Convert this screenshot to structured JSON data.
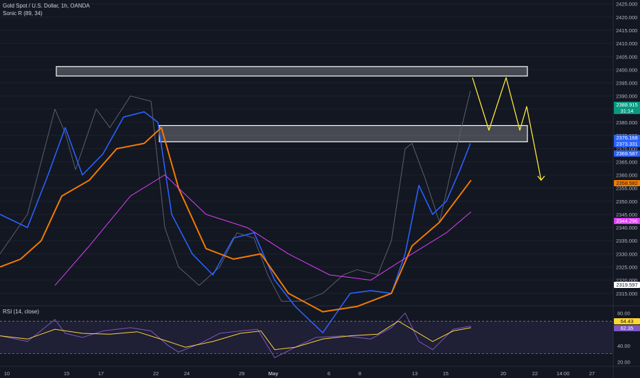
{
  "header": {
    "symbol_line": "Gold Spot / U.S. Dollar, 1h, OANDA",
    "indicator": "Sonic R (89, 34)",
    "rsi_label": "RSI (14, close)"
  },
  "colors": {
    "background": "#131722",
    "ema_fast": "#2962ff",
    "ema_slow": "#f57c00",
    "long_ma": "#e040fb",
    "projection": "#ffeb3b",
    "zone_fill": "rgba(255,255,255,0.22)",
    "rsi": "#7e57c2",
    "rsi_ma": "#fdd835"
  },
  "chart_data": [
    {
      "type": "line",
      "title": "Gold Spot / U.S. Dollar, 1h, OANDA",
      "x_labels": [
        "10",
        "15",
        "17",
        "22",
        "24",
        "29",
        "May",
        "6",
        "8",
        "13",
        "15",
        "20",
        "22",
        "14:00",
        "27"
      ],
      "y_ticks": [
        2315.0,
        2320.0,
        2325.0,
        2330.0,
        2335.0,
        2340.0,
        2345.0,
        2350.0,
        2355.0,
        2360.0,
        2365.0,
        2370.0,
        2375.0,
        2380.0,
        2385.0,
        2390.0,
        2395.0,
        2400.0,
        2405.0,
        2410.0,
        2415.0,
        2420.0,
        2425.0
      ],
      "y_range": [
        2310.5,
        2426.5
      ],
      "series": [
        {
          "name": "price_close",
          "x": [
            0,
            40,
            80,
            95,
            110,
            140,
            160,
            190,
            220,
            240,
            260,
            290,
            320,
            345,
            370,
            390,
            410,
            440,
            470,
            500,
            520,
            550,
            570,
            590,
            600,
            620,
            640,
            660,
            685
          ],
          "values": [
            2330,
            2345,
            2385,
            2376,
            2362,
            2385,
            2378,
            2390,
            2388,
            2340,
            2325,
            2318,
            2325,
            2338,
            2336,
            2322,
            2312,
            2312,
            2315,
            2322,
            2324,
            2322,
            2335,
            2370,
            2372,
            2358,
            2342,
            2365,
            2392
          ]
        },
        {
          "name": "ema_fast",
          "x": [
            0,
            40,
            70,
            95,
            120,
            150,
            180,
            210,
            230,
            250,
            280,
            310,
            340,
            370,
            400,
            430,
            470,
            510,
            540,
            570,
            590,
            610,
            630,
            650,
            670,
            685
          ],
          "values": [
            2345,
            2340,
            2360,
            2378,
            2360,
            2368,
            2382,
            2384,
            2380,
            2345,
            2330,
            2322,
            2336,
            2338,
            2320,
            2310,
            2300,
            2315,
            2316,
            2315,
            2330,
            2356,
            2345,
            2350,
            2362,
            2372
          ]
        },
        {
          "name": "ema_slow",
          "x": [
            0,
            30,
            60,
            90,
            130,
            170,
            210,
            235,
            260,
            300,
            340,
            380,
            420,
            470,
            520,
            570,
            600,
            640,
            686
          ],
          "values": [
            2325,
            2328,
            2335,
            2352,
            2358,
            2370,
            2372,
            2378,
            2355,
            2332,
            2328,
            2330,
            2315,
            2308,
            2310,
            2315,
            2333,
            2342,
            2358
          ]
        },
        {
          "name": "long_ma",
          "x": [
            80,
            130,
            190,
            240,
            300,
            360,
            420,
            480,
            540,
            600,
            650,
            686
          ],
          "values": [
            2318,
            2333,
            2352,
            2360,
            2345,
            2340,
            2330,
            2322,
            2320,
            2330,
            2338,
            2346
          ]
        },
        {
          "name": "projection",
          "x": [
            688,
            712,
            737,
            757,
            767,
            788
          ],
          "values": [
            2397,
            2377,
            2397,
            2377,
            2386,
            2358
          ]
        }
      ],
      "zones": [
        {
          "from": 2397.6,
          "to": 2401.2,
          "x_start": 82,
          "x_end": 768
        },
        {
          "from": 2372.6,
          "to": 2378.8,
          "x_start": 232,
          "x_end": 768
        }
      ],
      "price_tags": [
        {
          "value": "2388.915",
          "sub": "31:14",
          "color": "#089981",
          "text_color": "#ffffff"
        },
        {
          "value": "2376.168",
          "color": "#2962ff",
          "text_color": "#ffffff"
        },
        {
          "value": "2373.331",
          "color": "#2962ff",
          "text_color": "#ffffff"
        },
        {
          "value": "2369.587",
          "color": "#2962ff",
          "text_color": "#ffffff"
        },
        {
          "value": "2358.582",
          "color": "#f57c00",
          "text_color": "#131722"
        },
        {
          "value": "2344.296",
          "color": "#e040fb",
          "text_color": "#ffffff"
        },
        {
          "value": "2319.597",
          "color": "#ffffff",
          "text_color": "#131722"
        }
      ]
    },
    {
      "type": "line",
      "title": "RSI (14, close)",
      "y_ticks": [
        20.0,
        40.0,
        60.0,
        80.0
      ],
      "y_range": [
        17,
        88
      ],
      "bands": [
        30,
        70
      ],
      "series": [
        {
          "name": "rsi",
          "x": [
            0,
            40,
            80,
            95,
            120,
            150,
            190,
            220,
            245,
            260,
            290,
            320,
            350,
            375,
            400,
            430,
            460,
            500,
            540,
            570,
            590,
            610,
            630,
            660,
            686
          ],
          "values": [
            52,
            45,
            72,
            55,
            50,
            58,
            62,
            58,
            40,
            32,
            42,
            55,
            58,
            60,
            25,
            38,
            50,
            52,
            48,
            62,
            80,
            45,
            35,
            60,
            64
          ]
        },
        {
          "name": "rsi_ma",
          "x": [
            0,
            40,
            80,
            120,
            160,
            200,
            245,
            270,
            310,
            350,
            380,
            400,
            430,
            470,
            510,
            550,
            580,
            600,
            630,
            660,
            686
          ],
          "values": [
            52,
            48,
            60,
            55,
            54,
            57,
            45,
            38,
            45,
            55,
            58,
            35,
            38,
            48,
            52,
            54,
            70,
            60,
            45,
            58,
            62
          ]
        }
      ],
      "value_tags": [
        {
          "value": "64.43",
          "color": "#fdd835",
          "text_color": "#131722"
        },
        {
          "value": "62.35",
          "color": "#7e57c2",
          "text_color": "#ffffff"
        }
      ]
    }
  ]
}
